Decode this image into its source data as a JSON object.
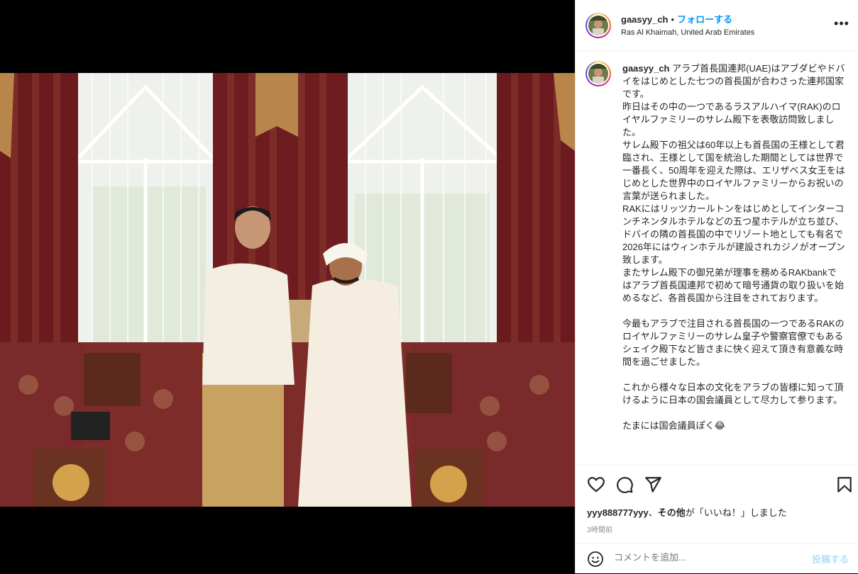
{
  "post": {
    "username": "gaasyy_ch",
    "follow_label": "フォローする",
    "dot": "•",
    "location": "Ras Al Khaimah, United Arab Emirates",
    "more_label": "•••"
  },
  "caption": {
    "username": "gaasyy_ch",
    "paragraphs": [
      "アラブ首長国連邦(UAE)はアブダビやドバイをはじめとした七つの首長国が合わさった連邦国家です。",
      "昨日はその中の一つであるラスアルハイマ(RAK)のロイヤルファミリーのサレム殿下を表敬訪問致しました。",
      "サレム殿下の祖父は60年以上も首長国の王様として君臨され、王様として国を統治した期間としては世界で一番長く、50周年を迎えた際は、エリザベス女王をはじめとした世界中のロイヤルファミリーからお祝いの言葉が送られました。",
      "RAKにはリッツカールトンをはじめとしてインターコンチネンタルホテルなどの五つ星ホテルが立ち並び、ドバイの隣の首長国の中でリゾート地としても有名で2026年にはウィンホテルが建設されカジノがオープン致します。",
      "またサレム殿下の御兄弟が理事を務めるRAKbankではアラブ首長国連邦で初めて暗号通貨の取り扱いを始めるなど、各首長国から注目をされております。",
      "",
      "今最もアラブで注目される首長国の一つであるRAKのロイヤルファミリーのサレム皇子や警察官僚でもあるシェイク殿下など皆さまに快く迎えて頂き有意義な時間を過ごせました。",
      "",
      "これから様々な日本の文化をアラブの皆様に知って頂けるように日本の国会議員として尽力して参ります。",
      "",
      "たまには国会議員ぽく😂"
    ]
  },
  "likes": {
    "user": "yyy888777yyy",
    "sep": "、",
    "others": "その他",
    "suffix": "が「いいね！」しました"
  },
  "time": "3時間前",
  "comment": {
    "placeholder": "コメントを追加...",
    "post_label": "投稿する"
  },
  "colors": {
    "accent": "#0095f6",
    "post_disabled": "#b2dffc",
    "text": "#262626",
    "muted": "#8e8e8e"
  }
}
